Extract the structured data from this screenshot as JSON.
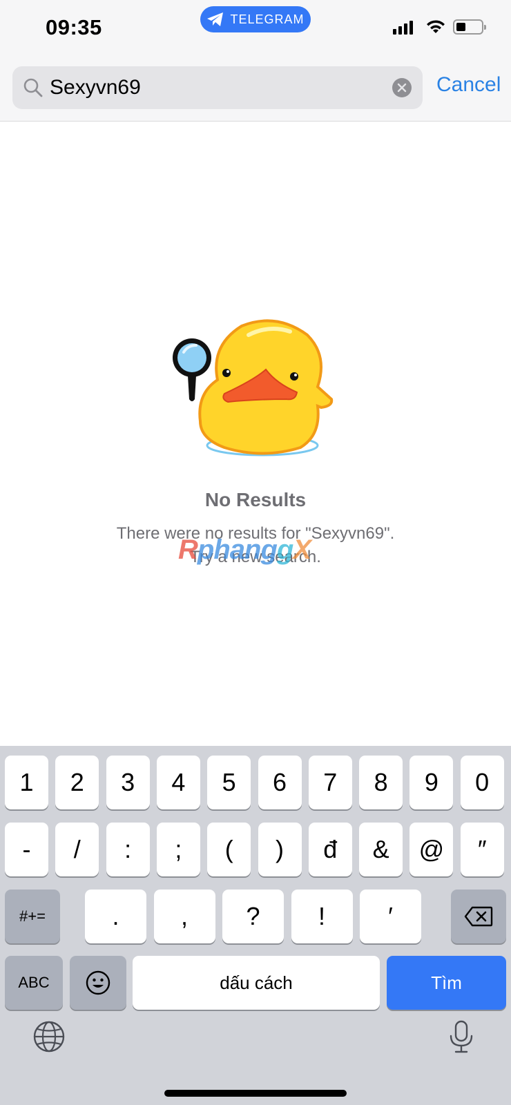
{
  "status_bar": {
    "time": "09:35",
    "app_pill": "TELEGRAM"
  },
  "search": {
    "value": "Sexyvn69",
    "cancel_label": "Cancel"
  },
  "empty_state": {
    "title": "No Results",
    "message": "There were no results for \"Sexyvn69\".",
    "hint": "Try a new search.",
    "watermark": [
      "R",
      "phang",
      "g",
      "X"
    ]
  },
  "keyboard": {
    "row1": [
      "1",
      "2",
      "3",
      "4",
      "5",
      "6",
      "7",
      "8",
      "9",
      "0"
    ],
    "row2": [
      "-",
      "/",
      ":",
      ";",
      "(",
      ")",
      "đ",
      "&",
      "@",
      "″"
    ],
    "row3": [
      ".",
      ",",
      "?",
      "!",
      "′"
    ],
    "symbols_label": "#+=",
    "abc_label": "ABC",
    "space_label": "dấu cách",
    "return_label": "Tìm"
  },
  "colors": {
    "accent": "#3478f6",
    "link": "#2a82e4",
    "keyboard_bg": "#d1d3d9"
  }
}
